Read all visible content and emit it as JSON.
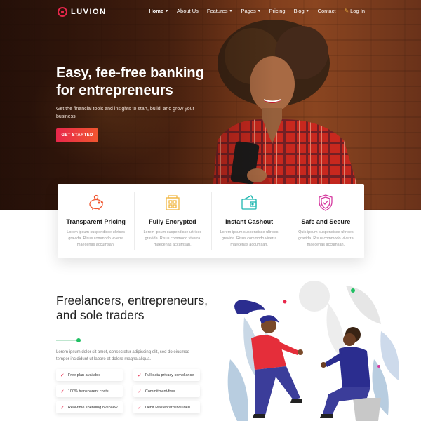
{
  "brand": {
    "name": "LUVION"
  },
  "nav": {
    "items": [
      {
        "label": "Home",
        "dropdown": true,
        "active": true
      },
      {
        "label": "About Us",
        "dropdown": false
      },
      {
        "label": "Features",
        "dropdown": true
      },
      {
        "label": "Pages",
        "dropdown": true
      },
      {
        "label": "Pricing",
        "dropdown": false
      },
      {
        "label": "Blog",
        "dropdown": true
      },
      {
        "label": "Contact",
        "dropdown": false
      }
    ],
    "login": "Log In"
  },
  "hero": {
    "title_line1": "Easy, fee-free banking",
    "title_line2": "for entrepreneurs",
    "subtitle": "Get the financial tools and insights to start, build, and grow your business.",
    "cta": "GET STARTED"
  },
  "features": [
    {
      "title": "Transparent Pricing",
      "text": "Lorem ipsum suspendisse ultrices gravida. Risus commodo viverra maecenas accumsan.",
      "icon": "piggy-bank-icon"
    },
    {
      "title": "Fully Encrypted",
      "text": "Lorem ipsum suspendisse ultrices gravida. Risus commodo viverra maecenas accumsan.",
      "icon": "vault-icon"
    },
    {
      "title": "Instant Cashout",
      "text": "Lorem ipsum suspendisse ultrices gravida. Risus commodo viverra maecenas accumsan.",
      "icon": "wallet-icon"
    },
    {
      "title": "Safe and Secure",
      "text": "Quis ipsum suspendisse ultrices gravida. Risus commodo viverra maecenas accumsan.",
      "icon": "shield-check-icon"
    }
  ],
  "section": {
    "title": "Freelancers, entrepreneurs, and sole traders",
    "text": "Lorem ipsum dolor sit amet, consectetur adipiscing elit, sed do eiusmod tempor incididunt ut labore et dolore magna aliqua.",
    "checks": [
      "Free plan available",
      "Full data privacy compliance",
      "100% transparent costs",
      "Commitment-free",
      "Real-time spending overview",
      "Debit Mastercard included"
    ]
  },
  "colors": {
    "accent": "#e8274b",
    "accent2": "#f0562f",
    "green": "#20c063",
    "navy": "#2b2d8f",
    "red_shirt": "#e52e3a"
  }
}
